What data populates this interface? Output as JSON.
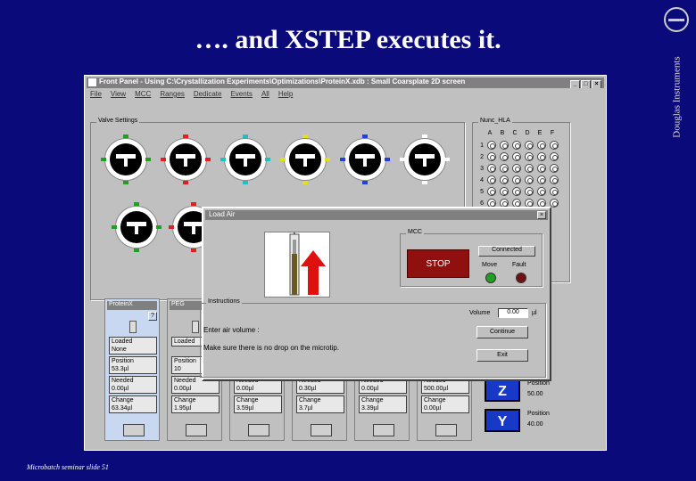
{
  "slide": {
    "title": "…. and XSTEP executes it.",
    "brand": "Douglas Instruments",
    "footer": "Microbatch seminar slide 51"
  },
  "window": {
    "title": "Front Panel - Using C:\\Crystallization Experiments\\Optimizations\\ProteinX.xdb : Small Coarsplate 2D screen",
    "menu": [
      "File",
      "View",
      "MCC",
      "Ranges",
      "Dedicate",
      "Events",
      "All",
      "Help"
    ]
  },
  "valve_settings": {
    "label": "Valve Settings"
  },
  "plate": {
    "label": "Nunc_HLA",
    "columns": [
      "A",
      "B",
      "C",
      "D",
      "E",
      "F"
    ],
    "rows": [
      "1",
      "2",
      "3",
      "4",
      "5",
      "6"
    ]
  },
  "syringes": [
    {
      "name": "ProteinX",
      "loaded_label": "Loaded",
      "loaded": "None",
      "position_label": "Position",
      "position": "53.3µl",
      "needed_label": "Needed",
      "needed": "0.00µl",
      "change_label": "Change",
      "change": "63.34µl"
    },
    {
      "name": "PEG",
      "loaded_label": "Loaded",
      "loaded": "",
      "position_label": "Position",
      "position": "10",
      "needed_label": "Needed",
      "needed": "0.00µl",
      "change_label": "Change",
      "change": "1.95µl"
    },
    {
      "name": "",
      "needed_label": "Needed",
      "needed": "0.00µl",
      "change_label": "Change",
      "change": "3.59µl"
    },
    {
      "name": "",
      "needed_label": "Needed",
      "needed": "0.30µl",
      "change_label": "Change",
      "change": "3.7µl"
    },
    {
      "name": "",
      "needed_label": "Needed",
      "needed": "0.00µl",
      "change_label": "Change",
      "change": "3.39µl"
    },
    {
      "name": "",
      "needed_label": "Needed",
      "needed": "500.00µl",
      "change_label": "Change",
      "change": "0.00µl"
    }
  ],
  "axes": [
    {
      "letter": "Z",
      "label": "Position",
      "value": "50.00"
    },
    {
      "letter": "Y",
      "label": "Position",
      "value": "40.00"
    }
  ],
  "dialog": {
    "title": "Load Air",
    "mcc_label": "MCC",
    "stop": "STOP",
    "connected": "Connected",
    "move": "Move",
    "fault": "Fault",
    "instructions_label": "Instructions",
    "volume_label": "Volume",
    "volume_value": "0.00",
    "volume_unit": "µl",
    "instruction1": "Enter air volume :",
    "instruction2": "Make sure there is no drop on the microtip.",
    "continue": "Continue",
    "exit": "Exit"
  },
  "colors": {
    "accent_stop": "#901010",
    "led_move": "#20a020",
    "led_fault": "#701010",
    "arrow": "#e01010",
    "axis_btn": "#1838c8"
  }
}
